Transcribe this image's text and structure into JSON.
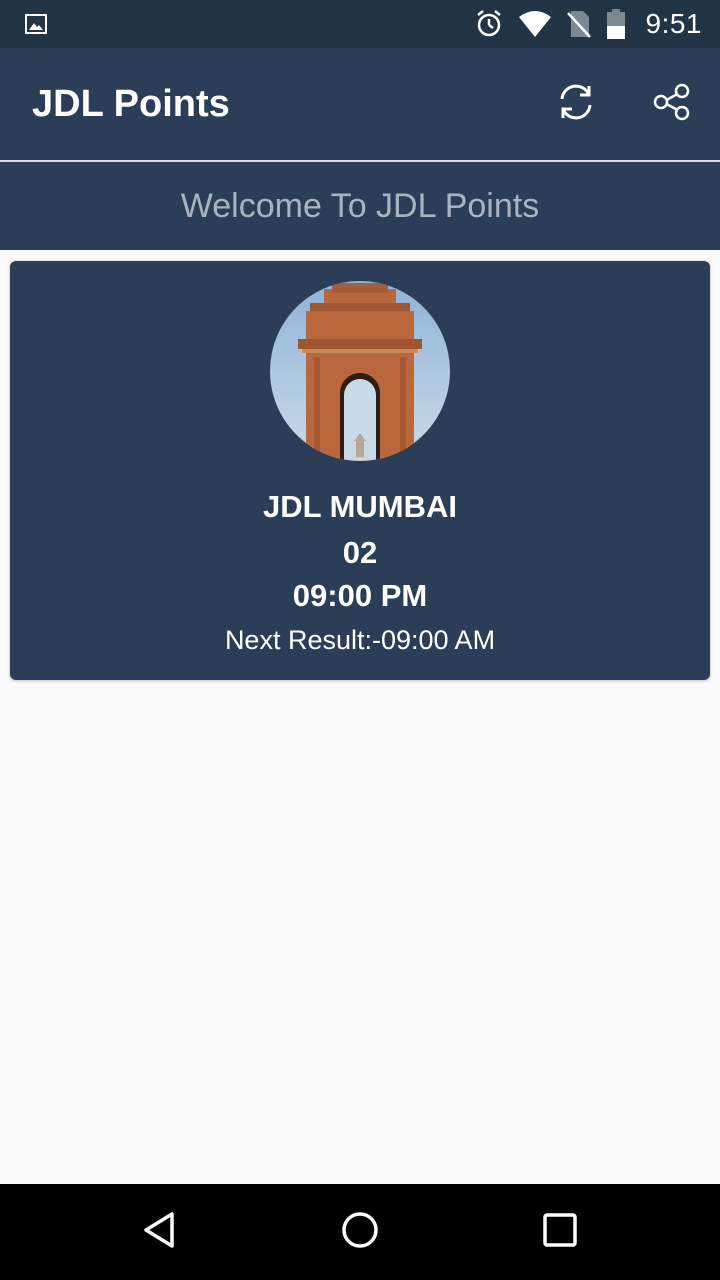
{
  "status_bar": {
    "time": "9:51",
    "icons": [
      "gallery-icon",
      "alarm-icon",
      "wifi-icon",
      "no-sim-icon",
      "battery-icon"
    ]
  },
  "app_bar": {
    "title": "JDL Points",
    "actions": [
      "refresh-icon",
      "share-icon"
    ]
  },
  "banner": {
    "text": "Welcome To JDL Points"
  },
  "result_card": {
    "image": "india-gate-image",
    "game_name": "JDL MUMBAI",
    "result_number": "02",
    "result_time": "09:00 PM",
    "next_result": "Next Result:-09:00 AM"
  },
  "nav_bar": {
    "buttons": [
      "back-icon",
      "home-icon",
      "recents-icon"
    ]
  },
  "colors": {
    "status_bar": "#243447",
    "primary": "#2c3e57",
    "banner_text": "#a9b4c0",
    "background": "#fafafa"
  }
}
